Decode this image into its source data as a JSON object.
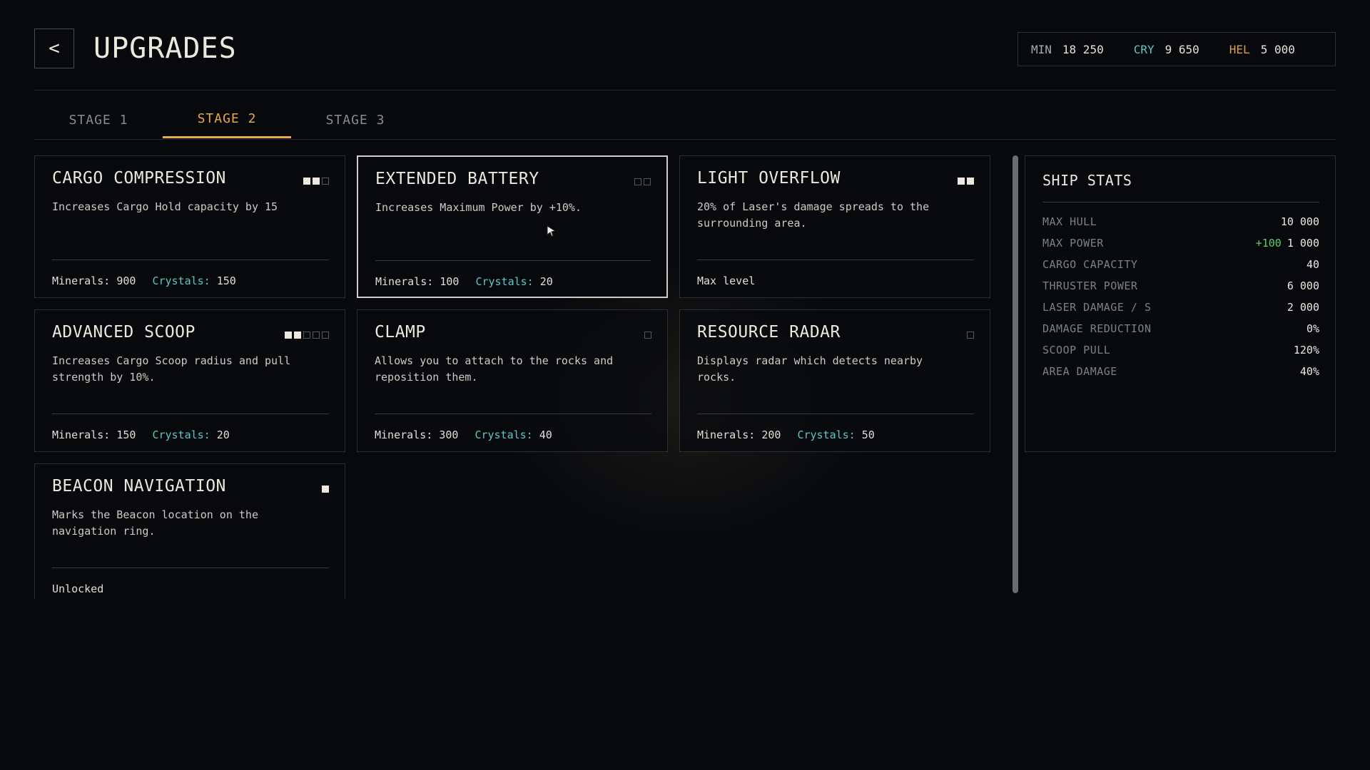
{
  "header": {
    "back_label": "<",
    "title": "UPGRADES"
  },
  "resources": [
    {
      "code": "MIN",
      "amount": "18 250",
      "color": "#a8aaae"
    },
    {
      "code": "CRY",
      "amount": "9 650",
      "color": "#5fc6c4"
    },
    {
      "code": "HEL",
      "amount": "5 000",
      "color": "#d6a04a"
    }
  ],
  "tabs": [
    {
      "label": "STAGE 1",
      "active": false
    },
    {
      "label": "STAGE 2",
      "active": true
    },
    {
      "label": "STAGE 3",
      "active": false
    }
  ],
  "upgrades": [
    {
      "title": "CARGO COMPRESSION",
      "description": "Increases Cargo Hold capacity by 15",
      "cost_minerals_label": "Minerals:",
      "cost_minerals": "900",
      "cost_crystals_label": "Crystals:",
      "cost_crystals": "150",
      "status": "",
      "level": 2,
      "max_level": 3
    },
    {
      "title": "EXTENDED BATTERY",
      "description": "Increases Maximum Power by +10%.",
      "cost_minerals_label": "Minerals:",
      "cost_minerals": "100",
      "cost_crystals_label": "Crystals:",
      "cost_crystals": "20",
      "status": "",
      "level": 0,
      "max_level": 2,
      "selected": true
    },
    {
      "title": "LIGHT OVERFLOW",
      "description": "20% of Laser's damage spreads to the surrounding area.",
      "status": "Max level",
      "level": 2,
      "max_level": 2
    },
    {
      "title": "ADVANCED SCOOP",
      "description": "Increases Cargo Scoop radius and pull strength by 10%.",
      "cost_minerals_label": "Minerals:",
      "cost_minerals": "150",
      "cost_crystals_label": "Crystals:",
      "cost_crystals": "20",
      "status": "",
      "level": 2,
      "max_level": 5
    },
    {
      "title": "CLAMP",
      "description": "Allows you to attach to the rocks and reposition them.",
      "cost_minerals_label": "Minerals:",
      "cost_minerals": "300",
      "cost_crystals_label": "Crystals:",
      "cost_crystals": "40",
      "status": "",
      "level": 0,
      "max_level": 1
    },
    {
      "title": "RESOURCE RADAR",
      "description": "Displays radar which detects nearby rocks.",
      "cost_minerals_label": "Minerals:",
      "cost_minerals": "200",
      "cost_crystals_label": "Crystals:",
      "cost_crystals": "50",
      "status": "",
      "level": 0,
      "max_level": 1
    },
    {
      "title": "BEACON NAVIGATION",
      "description": "Marks the Beacon location on the navigation ring.",
      "status": "Unlocked",
      "level": 1,
      "max_level": 1
    }
  ],
  "ship_stats": {
    "title": "SHIP STATS",
    "rows": [
      {
        "name": "MAX HULL",
        "value": "10 000",
        "bonus": ""
      },
      {
        "name": "MAX POWER",
        "value": "1 000",
        "bonus": "+100"
      },
      {
        "name": "CARGO CAPACITY",
        "value": "40",
        "bonus": ""
      },
      {
        "name": "THRUSTER POWER",
        "value": "6 000",
        "bonus": ""
      },
      {
        "name": "LASER DAMAGE / S",
        "value": "2 000",
        "bonus": ""
      },
      {
        "name": "DAMAGE REDUCTION",
        "value": "0%",
        "bonus": ""
      },
      {
        "name": "SCOOP PULL",
        "value": "120%",
        "bonus": ""
      },
      {
        "name": "AREA DAMAGE",
        "value": "40%",
        "bonus": ""
      }
    ]
  },
  "colors": {
    "accent": "#e8a84a",
    "crystal": "#5fc6c4",
    "bonus": "#5ad06a"
  }
}
